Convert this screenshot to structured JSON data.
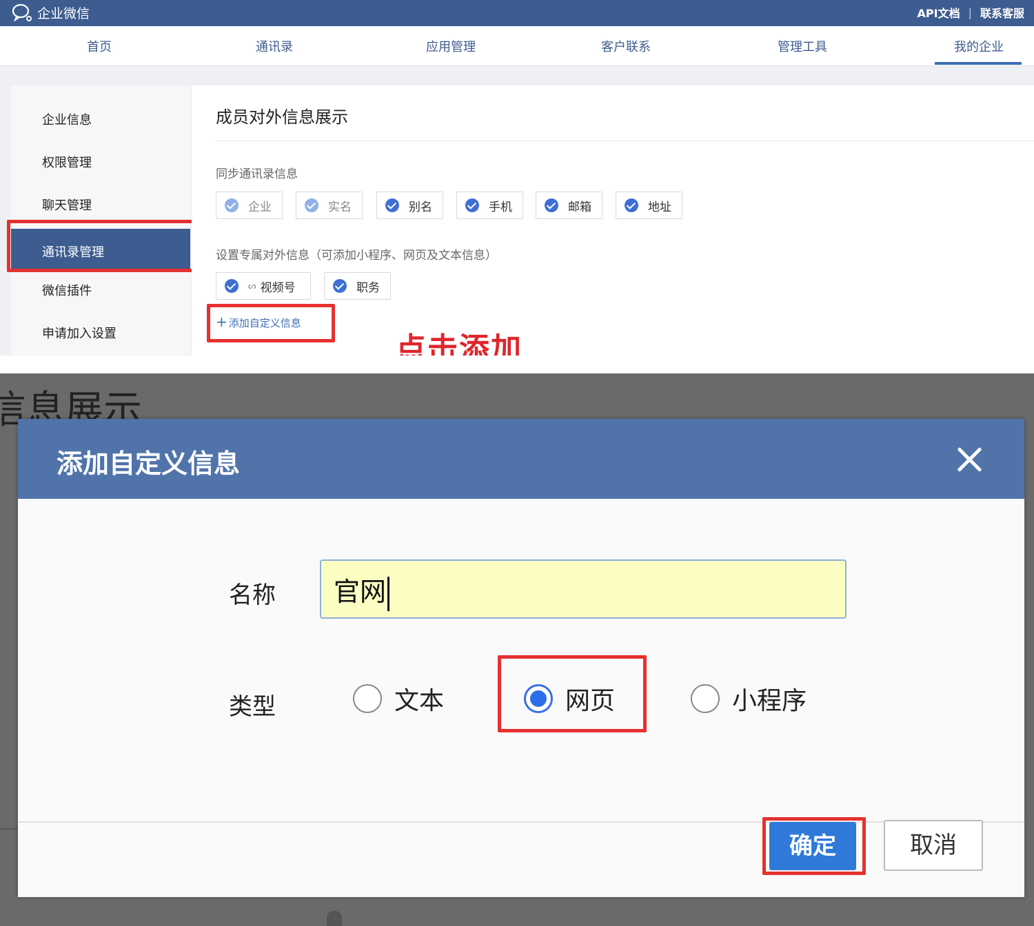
{
  "app": {
    "title": "企业微信",
    "api_docs": "API文档",
    "separator": "|",
    "support": "联系客服"
  },
  "nav": {
    "items": [
      "首页",
      "通讯录",
      "应用管理",
      "客户联系",
      "管理工具",
      "我的企业"
    ]
  },
  "sidebar": {
    "items": [
      "企业信息",
      "权限管理",
      "聊天管理",
      "通讯录管理",
      "微信插件",
      "申请加入设置"
    ]
  },
  "content": {
    "title": "成员对外信息展示",
    "sync_label": "同步通讯录信息",
    "sync_chips": [
      "企业",
      "实名",
      "别名",
      "手机",
      "邮箱",
      "地址"
    ],
    "custom_label": "设置专属对外信息（可添加小程序、网页及文本信息）",
    "custom_chips": [
      "视频号",
      "职务"
    ],
    "add_link_plus": "+",
    "add_link": "添加自定义信息"
  },
  "annotation": "点击添加",
  "background": {
    "title": "信息展示"
  },
  "dialog": {
    "title": "添加自定义信息",
    "name_label": "名称",
    "name_value": "官网",
    "type_label": "类型",
    "types": [
      "文本",
      "网页",
      "小程序"
    ],
    "selected_type": "网页",
    "ok": "确定",
    "cancel": "取消"
  },
  "colors": {
    "brand": "#3d5c8f",
    "dialog_header": "#5073aa",
    "primary_button": "#2f79d9",
    "highlight_red": "#e5312f",
    "input_bg": "#fbfdc2"
  }
}
